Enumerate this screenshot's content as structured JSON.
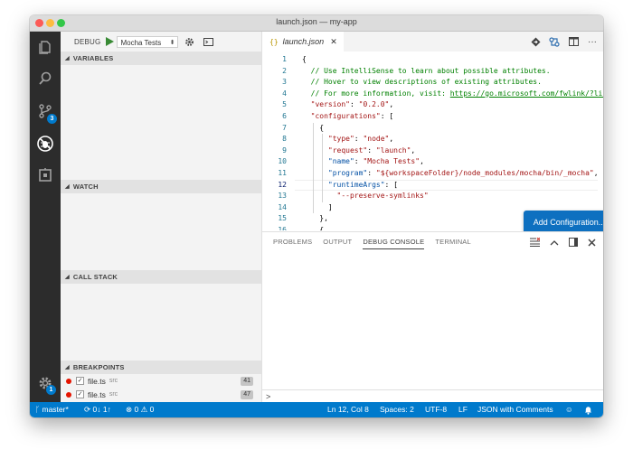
{
  "window": {
    "title": "launch.json — my-app"
  },
  "activitybar": {
    "scm_badge": "3",
    "settings_badge": "1"
  },
  "debug": {
    "label": "DEBUG",
    "config_selected": "Mocha Tests"
  },
  "sections": {
    "variables": "VARIABLES",
    "watch": "WATCH",
    "callstack": "CALL STACK",
    "breakpoints": "BREAKPOINTS"
  },
  "breakpoints": [
    {
      "file": "file.ts",
      "folder": "src",
      "line": "41"
    },
    {
      "file": "file.ts",
      "folder": "src",
      "line": "47"
    }
  ],
  "editor": {
    "tab_label": "launch.json",
    "tab_icon": "{}",
    "lines": [
      {
        "n": "1",
        "segs": [
          [
            "c-brk",
            "{"
          ]
        ]
      },
      {
        "n": "2",
        "segs": [
          [
            "c-comment",
            "  // Use IntelliSense to learn about possible attributes."
          ]
        ]
      },
      {
        "n": "3",
        "segs": [
          [
            "c-comment",
            "  // Hover to view descriptions of existing attributes."
          ]
        ]
      },
      {
        "n": "4",
        "segs": [
          [
            "c-comment",
            "  // For more information, visit: "
          ],
          [
            "c-link",
            "https://go.microsoft.com/fwlink/?linkid"
          ]
        ]
      },
      {
        "n": "5",
        "segs": [
          [
            "c-str",
            "  \"version\""
          ],
          [
            "c-brk",
            ": "
          ],
          [
            "c-strv",
            "\"0.2.0\""
          ],
          [
            "c-brk",
            ","
          ]
        ]
      },
      {
        "n": "6",
        "segs": [
          [
            "c-str",
            "  \"configurations\""
          ],
          [
            "c-brk",
            ": ["
          ]
        ]
      },
      {
        "n": "7",
        "segs": [
          [
            "c-brk",
            "    {"
          ]
        ]
      },
      {
        "n": "8",
        "segs": [
          [
            "c-str",
            "      \"type\""
          ],
          [
            "c-brk",
            ": "
          ],
          [
            "c-strv",
            "\"node\""
          ],
          [
            "c-brk",
            ","
          ]
        ]
      },
      {
        "n": "9",
        "segs": [
          [
            "c-str",
            "      \"request\""
          ],
          [
            "c-brk",
            ": "
          ],
          [
            "c-strv",
            "\"launch\""
          ],
          [
            "c-brk",
            ","
          ]
        ]
      },
      {
        "n": "10",
        "segs": [
          [
            "c-key",
            "      \"name\""
          ],
          [
            "c-brk",
            ": "
          ],
          [
            "c-strv",
            "\"Mocha Tests\""
          ],
          [
            "c-brk",
            ","
          ]
        ]
      },
      {
        "n": "11",
        "segs": [
          [
            "c-key",
            "      \"program\""
          ],
          [
            "c-brk",
            ": "
          ],
          [
            "c-strv",
            "\"${workspaceFolder}/node_modules/mocha/bin/_mocha\""
          ],
          [
            "c-brk",
            ","
          ]
        ]
      },
      {
        "n": "12",
        "segs": [
          [
            "c-key",
            "      \"runtimeArgs\""
          ],
          [
            "c-brk",
            ": ["
          ]
        ]
      },
      {
        "n": "13",
        "segs": [
          [
            "c-strv",
            "        \"--preserve-symlinks\""
          ]
        ]
      },
      {
        "n": "14",
        "segs": [
          [
            "c-brk",
            "      ]"
          ]
        ]
      },
      {
        "n": "15",
        "segs": [
          [
            "c-brk",
            "    },"
          ]
        ]
      },
      {
        "n": "16",
        "segs": [
          [
            "c-brk",
            "    {"
          ]
        ]
      }
    ],
    "current_line": "12",
    "add_config_label": "Add Configuration..."
  },
  "panel": {
    "tabs": [
      "PROBLEMS",
      "OUTPUT",
      "DEBUG CONSOLE",
      "TERMINAL"
    ],
    "active_tab": "DEBUG CONSOLE",
    "input_prompt": ">"
  },
  "statusbar": {
    "branch": "master*",
    "sync": "0↓ 1↑",
    "errors": "0",
    "warnings": "0",
    "position": "Ln 12, Col 8",
    "spaces": "Spaces: 2",
    "encoding": "UTF-8",
    "eol": "LF",
    "language": "JSON with Comments"
  },
  "colors": {
    "statusbar": "#007acc",
    "activitybar": "#2c2c2c",
    "button": "#0e70c0",
    "breakpoint": "#e51400"
  }
}
